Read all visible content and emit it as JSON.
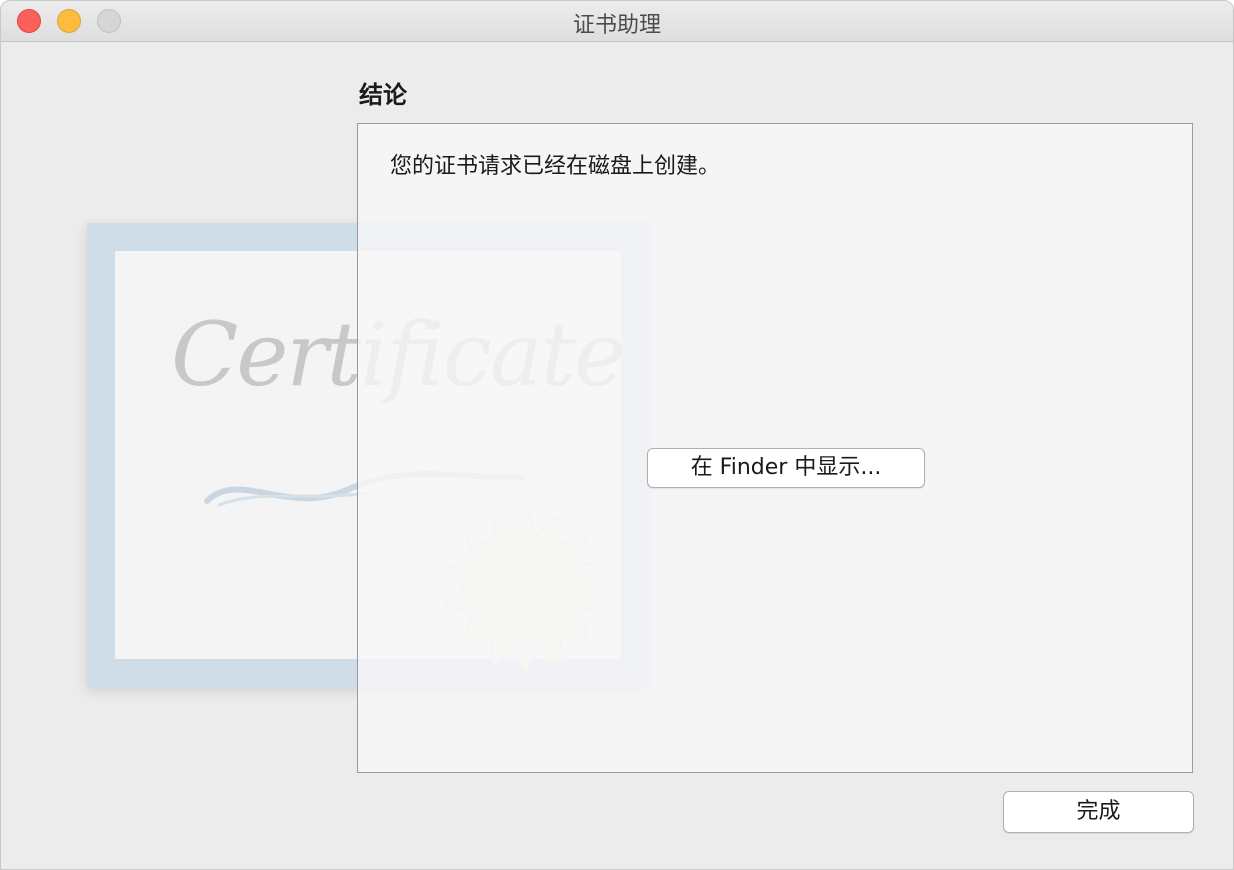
{
  "window": {
    "title": "证书助理"
  },
  "content": {
    "section_heading": "结论",
    "message": "您的证书请求已经在磁盘上创建。",
    "show_in_finder_label": "在 Finder 中显示...",
    "done_label": "完成"
  },
  "illustration": {
    "word": "Certificate",
    "seal_icon": "certificate-seal-icon"
  },
  "colors": {
    "close": "#fc605c",
    "minimize": "#fdbc40",
    "zoom_disabled": "#d6d6d6",
    "certificate_border": "#cfdde8"
  }
}
